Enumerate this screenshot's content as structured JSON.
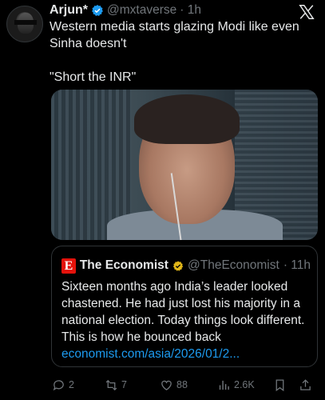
{
  "author": {
    "name": "Arjun*",
    "handle": "@mxtaverse",
    "time": "· 1h"
  },
  "tweet": {
    "line1": "Western media starts glazing Modi like even Sinha doesn't",
    "line2": "\"Short the INR\""
  },
  "quote": {
    "logo_letter": "E",
    "name": "The Economist",
    "handle": "@TheEconomist",
    "time": "· 11h",
    "text": "Sixteen months ago India’s leader looked chastened. He had just lost his majority in a national election. Today things look different. This is how he bounced back",
    "link": "economist.com/asia/2026/01/2..."
  },
  "actions": {
    "replies": "2",
    "reposts": "7",
    "likes": "88",
    "views": "2.6K"
  },
  "colors": {
    "accent": "#1d9bf0",
    "verified_gold": "#e2b719",
    "economist_red": "#e3120b"
  },
  "icons": [
    "verified-badge-icon",
    "x-logo-icon",
    "gold-checkmark-icon",
    "reply-icon",
    "repost-icon",
    "like-icon",
    "views-icon",
    "bookmark-icon",
    "share-icon"
  ]
}
